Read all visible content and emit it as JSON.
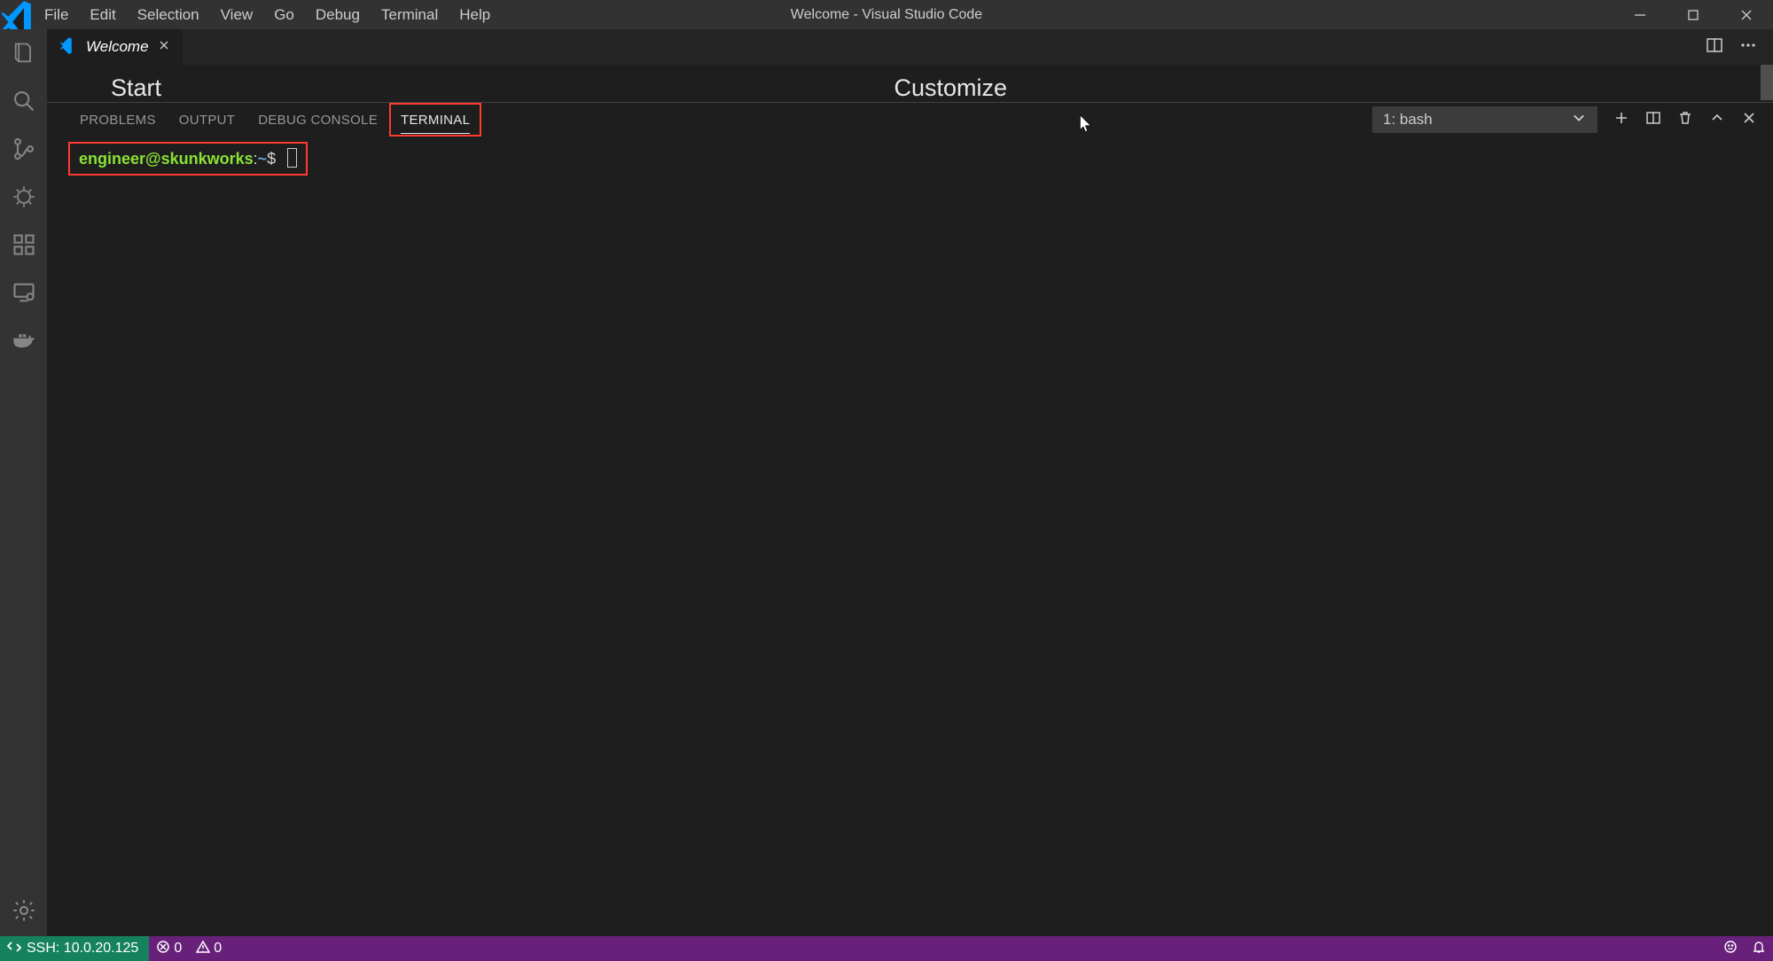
{
  "window": {
    "title": "Welcome - Visual Studio Code"
  },
  "menu": [
    "File",
    "Edit",
    "Selection",
    "View",
    "Go",
    "Debug",
    "Terminal",
    "Help"
  ],
  "tab": {
    "label": "Welcome"
  },
  "welcome": {
    "start_heading": "Start",
    "customize_heading": "Customize"
  },
  "panel": {
    "tabs": {
      "problems": "PROBLEMS",
      "output": "OUTPUT",
      "debug_console": "DEBUG CONSOLE",
      "terminal": "TERMINAL"
    },
    "terminal_select": "1: bash"
  },
  "terminal": {
    "user_host": "engineer@skunkworks",
    "colon": ":",
    "path": "~",
    "dollar": "$"
  },
  "statusbar": {
    "remote": "SSH: 10.0.20.125",
    "errors": "0",
    "warnings": "0"
  }
}
